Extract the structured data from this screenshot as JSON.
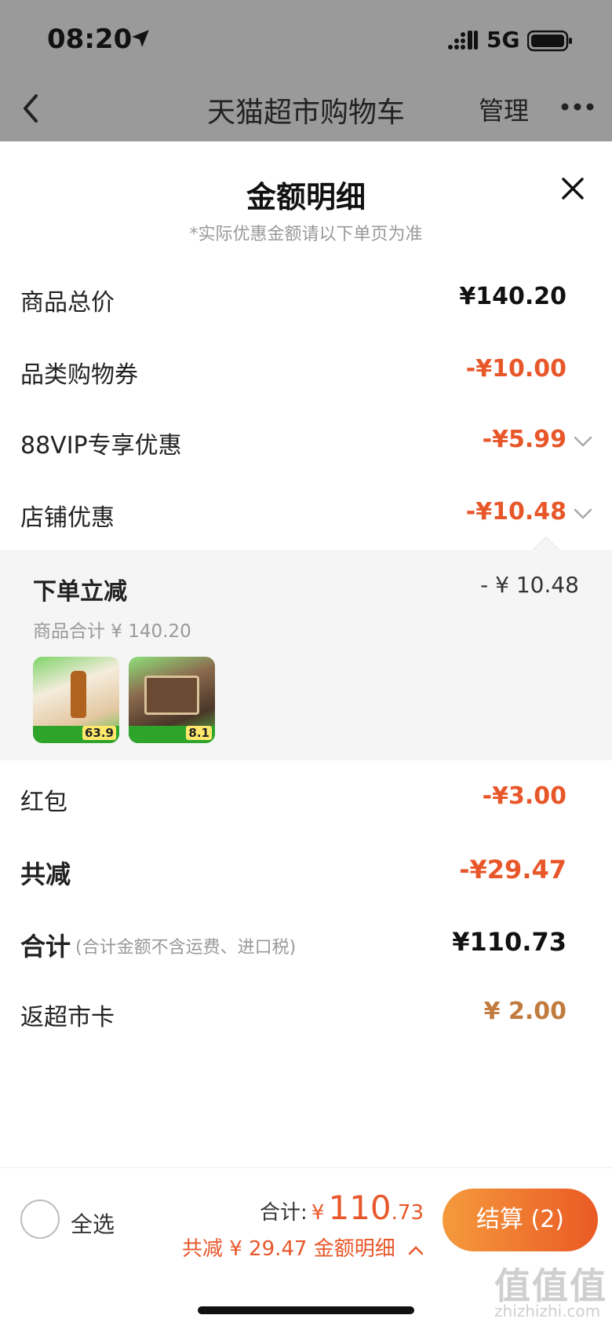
{
  "status_bar": {
    "time": "08:20",
    "network": "5G"
  },
  "nav": {
    "title": "天猫超市购物车",
    "manage": "管理"
  },
  "sheet": {
    "title": "金额明细",
    "subtitle": "*实际优惠金额请以下单页为准",
    "rows": [
      {
        "label": "商品总价",
        "value": "¥140.20"
      },
      {
        "label": "品类购物券",
        "value": "-¥10.00"
      },
      {
        "label": "88VIP专享优惠",
        "value": "-¥5.99"
      },
      {
        "label": "店铺优惠",
        "value": "-¥10.48"
      },
      {
        "label": "红包",
        "value": "-¥3.00"
      },
      {
        "label": "共减",
        "value": "-¥29.47"
      },
      {
        "label": "合计",
        "note": "(合计金额不含运费、进口税)",
        "value": "¥110.73"
      },
      {
        "label": "返超市卡",
        "value": "¥ 2.00"
      }
    ],
    "store_detail": {
      "title": "下单立减",
      "amount": "- ¥ 10.48",
      "subtotal": "商品合计 ¥ 140.20",
      "products": [
        {
          "price": "63.9"
        },
        {
          "price": "8.1"
        }
      ]
    }
  },
  "bottom_bar": {
    "select_all": "全选",
    "total_label": "合计:",
    "currency": "¥",
    "total_int": "110",
    "total_dec": ".73",
    "discount_text": "共减 ¥ 29.47  金额明细",
    "checkout": "结算 (2)"
  },
  "watermark": {
    "text": "值值值",
    "url": "zhizhizhi.com"
  }
}
